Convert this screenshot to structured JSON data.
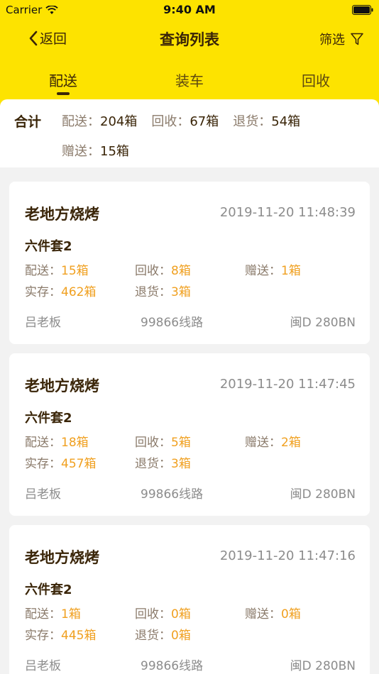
{
  "status_bar": {
    "carrier": "Carrier",
    "time": "9:40 AM"
  },
  "nav": {
    "back_label": "返回",
    "title": "查询列表",
    "filter_label": "筛选"
  },
  "tabs": [
    {
      "label": "配送",
      "active": true
    },
    {
      "label": "装车",
      "active": false
    },
    {
      "label": "回收",
      "active": false
    }
  ],
  "summary": {
    "label": "合计",
    "items": [
      {
        "key": "配送：",
        "value": "204箱"
      },
      {
        "key": "回收：",
        "value": "67箱"
      },
      {
        "key": "退货：",
        "value": "54箱"
      },
      {
        "key": "赠送：",
        "value": "15箱"
      }
    ]
  },
  "records": [
    {
      "shop": "老地方烧烤",
      "time": "2019-11-20 11:48:39",
      "product": "六件套2",
      "delivery": {
        "key": "配送：",
        "value": "15箱"
      },
      "recycle": {
        "key": "回收：",
        "value": "8箱"
      },
      "gift": {
        "key": "赠送：",
        "value": "1箱"
      },
      "stock": {
        "key": "实存：",
        "value": "462箱"
      },
      "returned": {
        "key": "退货：",
        "value": "3箱"
      },
      "boss": "吕老板",
      "route": "99866线路",
      "plate": "闽D 280BN"
    },
    {
      "shop": "老地方烧烤",
      "time": "2019-11-20 11:47:45",
      "product": "六件套2",
      "delivery": {
        "key": "配送：",
        "value": "18箱"
      },
      "recycle": {
        "key": "回收：",
        "value": "5箱"
      },
      "gift": {
        "key": "赠送：",
        "value": "2箱"
      },
      "stock": {
        "key": "实存：",
        "value": "457箱"
      },
      "returned": {
        "key": "退货：",
        "value": "3箱"
      },
      "boss": "吕老板",
      "route": "99866线路",
      "plate": "闽D 280BN"
    },
    {
      "shop": "老地方烧烤",
      "time": "2019-11-20 11:47:16",
      "product": "六件套2",
      "delivery": {
        "key": "配送：",
        "value": "1箱"
      },
      "recycle": {
        "key": "回收：",
        "value": "0箱"
      },
      "gift": {
        "key": "赠送：",
        "value": "0箱"
      },
      "stock": {
        "key": "实存：",
        "value": "445箱"
      },
      "returned": {
        "key": "退货：",
        "value": "0箱"
      },
      "boss": "吕老板",
      "route": "99866线路",
      "plate": "闽D 280BN"
    }
  ],
  "colors": {
    "header_bg": "#fde300",
    "title_text": "#3a2508",
    "accent_value": "#f0a020",
    "muted_text": "#8c8c8c"
  },
  "icons": [
    "wifi-icon",
    "battery-icon",
    "back-chevron-icon",
    "filter-icon"
  ]
}
